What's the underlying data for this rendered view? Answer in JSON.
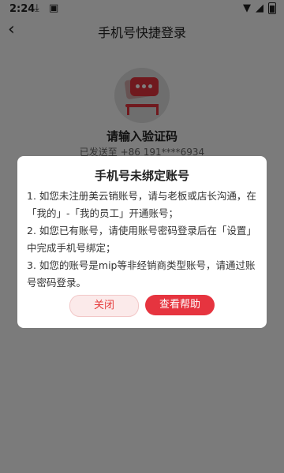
{
  "status_bar": {
    "time": "2:24"
  },
  "header": {
    "title": "手机号快捷登录"
  },
  "content": {
    "verify_title": "请输入验证码",
    "sent_text": "已发送至 +86 191****6934"
  },
  "dialog": {
    "title": "手机号未绑定账号",
    "lines": [
      "1. 如您未注册美云销账号，请与老板或店长沟通，在「我的」-「我的员工」开通账号；",
      "2. 如您已有账号，请使用账号密码登录后在「设置」中完成手机号绑定；",
      "3. 如您的账号是mip等非经销商类型账号，请通过账号密码登录。"
    ],
    "close_label": "关闭",
    "help_label": "查看帮助"
  },
  "colors": {
    "accent": "#e6343f",
    "overlay": "rgba(0,0,0,0.5)"
  },
  "icons": {
    "back": "chevron-left-icon",
    "download": "download-icon",
    "wifi": "wifi-icon",
    "signal": "signal-icon",
    "battery": "battery-icon"
  }
}
